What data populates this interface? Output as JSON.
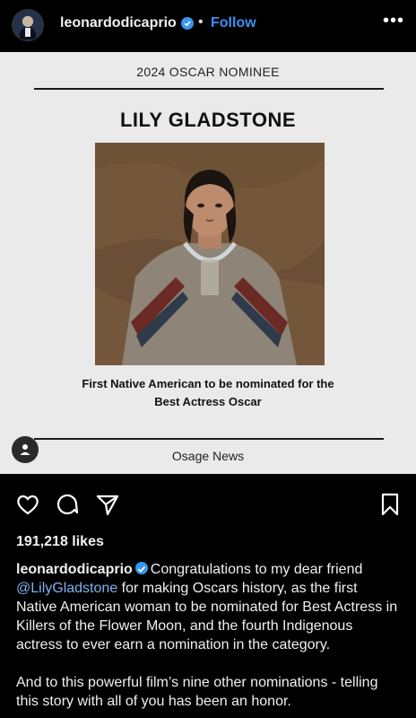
{
  "header": {
    "username": "leonardodicaprio",
    "separator": "•",
    "follow_label": "Follow",
    "more_label": "•••"
  },
  "post_image": {
    "kicker": "2024 OSCAR NOMINEE",
    "name": "LILY GLADSTONE",
    "caption_line1": "First Native American to be nominated for the",
    "caption_line2": "Best Actress Oscar",
    "source": "Osage News"
  },
  "likes": "191,218 likes",
  "caption": {
    "username": "leonardodicaprio",
    "text_before_mention": "Congratulations to my dear friend",
    "mention": "@LilyGladstone",
    "text_after_mention": " for making Oscars history, as the first Native American woman to be nominated for Best Actress in Killers of the Flower Moon, and the fourth Indigenous actress to ever earn a nomination in the category.",
    "paragraph2": "And to this powerful film’s nine other nominations - telling this story with all of you has been an honor."
  },
  "icons": {
    "avatar": "profile-avatar",
    "verified": "verified-badge-icon",
    "like": "heart-icon",
    "comment": "comment-icon",
    "share": "send-icon",
    "save": "bookmark-icon",
    "tag": "user-tag-icon"
  },
  "colors": {
    "background": "#000000",
    "accent_blue": "#3d8ef0",
    "verified_blue": "#3897f0",
    "post_background": "#eaeaea"
  }
}
